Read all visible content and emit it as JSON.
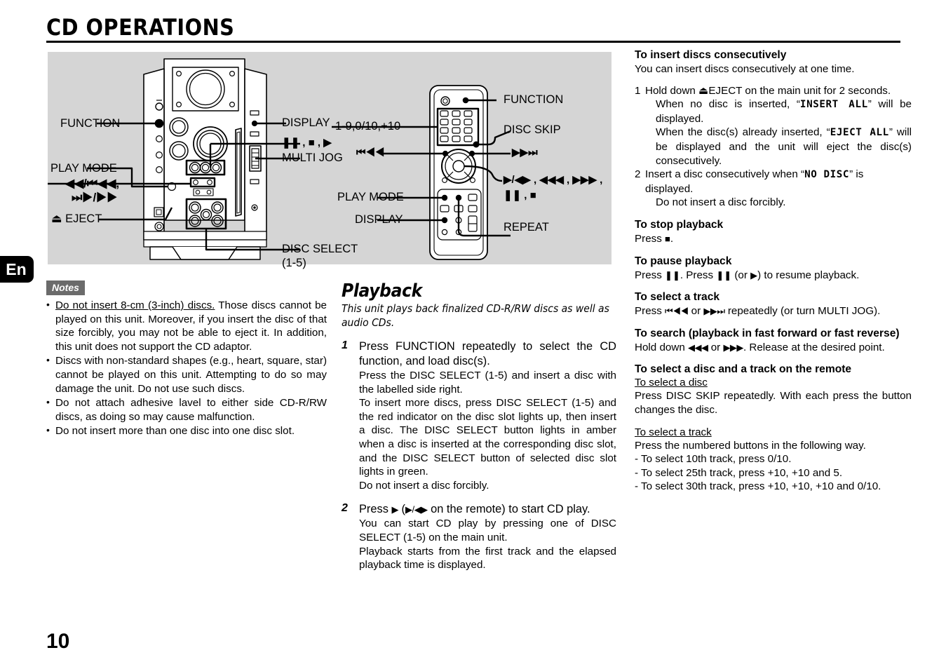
{
  "header": {
    "title": "CD OPERATIONS"
  },
  "language_tab": "En",
  "page_number": "10",
  "diagram": {
    "main_unit_labels": {
      "function": "FUNCTION",
      "play_mode": "PLAY MODE",
      "skip_symbols": "◀◀/⏮◀◀,",
      "skip_symbols2": "⏭▶/▶▶",
      "eject": "⏏ EJECT",
      "display": "DISPLAY",
      "transport_symbols": "❚❚ , ■ , ▶",
      "multi_jog": "MULTI JOG",
      "disc_select": "DISC SELECT",
      "disc_select_range": "(1-5)"
    },
    "remote_labels": {
      "numeric_keys": "1-9,0/10,+10",
      "prev": "⏮◀◀",
      "play_mode": "PLAY MODE",
      "display": "DISPLAY",
      "function": "FUNCTION",
      "disc_skip": "DISC SKIP",
      "next": "▶▶⏭",
      "nav_symbols_line1": "▶/◀▶ , ◀◀◀ , ▶▶▶ ,",
      "nav_symbols_line2": "❚❚ , ■",
      "repeat": "REPEAT"
    }
  },
  "notes": {
    "badge": "Notes",
    "items": [
      {
        "underlined": "Do not insert 8-cm (3-inch) discs.",
        "rest": " Those discs cannot be played on this unit. Moreover, if you insert the disc of that size forcibly, you may not be able to eject it. In addition, this unit does not support the CD adaptor."
      },
      {
        "underlined": "",
        "rest": "Discs with non-standard shapes (e.g., heart, square, star) cannot be played on this unit. Attempting to do so may damage the unit. Do not use such discs."
      },
      {
        "underlined": "",
        "rest": "Do not attach adhesive lavel to either side CD-R/RW discs, as doing so may cause malfunction."
      },
      {
        "underlined": "",
        "rest": "Do not insert more than one disc into one disc slot."
      }
    ]
  },
  "playback": {
    "heading": "Playback",
    "lead": "This unit plays back finalized CD-R/RW discs as well as audio CDs.",
    "steps": [
      {
        "num": "1",
        "head": "Press FUNCTION repeatedly to select the CD function, and load disc(s).",
        "body": [
          "Press the DISC SELECT (1-5) and insert a disc with the labelled side right.",
          "To insert more discs, press DISC SELECT (1-5) and the red indicator on the disc slot lights up, then insert a disc. The DISC SELECT button lights in amber when a disc is inserted at the corresponding disc slot, and the DISC SELECT button of selected disc slot lights in green.",
          "Do not insert a disc forcibly."
        ]
      },
      {
        "num": "2",
        "head_pre": "Press ",
        "head_sym1": "▶",
        "head_mid": " (",
        "head_sym2": "▶/◀▶",
        "head_post": " on the remote) to start CD play.",
        "body": [
          "You can start CD play by pressing one of DISC SELECT (1-5) on the main unit.",
          "Playback starts from the first track and the elapsed playback time is displayed."
        ]
      }
    ]
  },
  "right_column": {
    "insert_consecutively": {
      "heading": "To insert discs consecutively",
      "intro": "You can insert discs consecutively at one time.",
      "step1_num": "1",
      "step1_pre": "Hold down ",
      "step1_eject": "⏏",
      "step1_post": "EJECT on the main unit for 2 seconds.",
      "step1_sub1_pre": "When no disc is inserted, “",
      "step1_sub1_lcd": "INSERT ALL",
      "step1_sub1_post": "” will be displayed.",
      "step1_sub2_pre": "When the disc(s) already inserted, “",
      "step1_sub2_lcd": "EJECT ALL",
      "step1_sub2_post": "” will be displayed and the unit will eject the disc(s) consecutively.",
      "step2_num": "2",
      "step2_pre": "Insert a disc consecutively when “",
      "step2_lcd": "NO DISC",
      "step2_post": "” is displayed.",
      "step2_sub": "Do not insert a disc forcibly."
    },
    "stop": {
      "heading": "To stop playback",
      "pre": "Press ",
      "sym": "■",
      "post": "."
    },
    "pause": {
      "heading": "To pause playback",
      "pre": "Press ",
      "sym1": "❚❚",
      "mid": ". Press ",
      "sym2": "❚❚",
      "mid2": " (or ",
      "sym3": "▶",
      "post": ") to resume playback."
    },
    "select_track": {
      "heading": "To select a track",
      "pre": "Press ",
      "sym1": "⏮◀◀",
      "mid": " or ",
      "sym2": "▶▶⏭",
      "post": " repeatedly (or turn MULTI JOG)."
    },
    "search": {
      "heading": "To search (playback in fast forward or fast reverse)",
      "pre": "Hold down ",
      "sym1": "◀◀◀",
      "mid": " or ",
      "sym2": "▶▶▶",
      "post": ". Release at the desired point."
    },
    "remote_select": {
      "heading": "To select a disc and a track on the remote",
      "sub1": "To select a disc",
      "sub1_body": "Press DISC SKIP repeatedly. With each press the button changes the disc.",
      "sub2": "To select a track",
      "sub2_body": "Press the numbered buttons in the following way.",
      "bullets": [
        "-  To select 10th track, press 0/10.",
        "-  To select 25th track, press +10, +10 and 5.",
        "-  To select 30th track, press +10, +10, +10 and 0/10."
      ]
    }
  }
}
